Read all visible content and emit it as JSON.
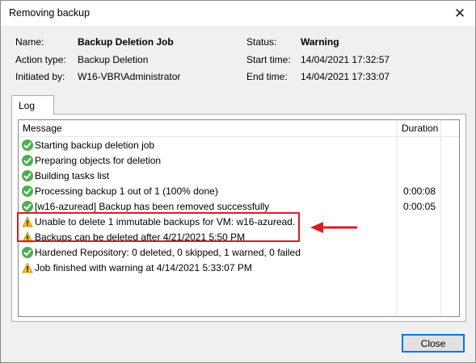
{
  "window": {
    "title": "Removing backup"
  },
  "info": {
    "name_label": "Name:",
    "name_value": "Backup Deletion Job",
    "action_label": "Action type:",
    "action_value": "Backup Deletion",
    "initiated_label": "Initiated by:",
    "initiated_value": "W16-VBR\\Administrator",
    "status_label": "Status:",
    "status_value": "Warning",
    "start_label": "Start time:",
    "start_value": "14/04/2021 17:32:57",
    "end_label": "End time:",
    "end_value": "14/04/2021 17:33:07"
  },
  "tabs": [
    {
      "label": "Log"
    }
  ],
  "log": {
    "columns": {
      "message": "Message",
      "duration": "Duration"
    },
    "rows": [
      {
        "status": "success",
        "message": "Starting backup deletion job",
        "duration": ""
      },
      {
        "status": "success",
        "message": "Preparing objects for deletion",
        "duration": ""
      },
      {
        "status": "success",
        "message": "Building tasks list",
        "duration": ""
      },
      {
        "status": "success",
        "message": "Processing backup 1 out of 1 (100% done)",
        "duration": "0:00:08"
      },
      {
        "status": "success",
        "message": "[w16-azuread] Backup has been removed successfully",
        "duration": "0:00:05"
      },
      {
        "status": "warning",
        "message": "Unable to delete 1 immutable backups for VM: w16-azuread.",
        "duration": ""
      },
      {
        "status": "warning",
        "message": "Backups can be deleted after 4/21/2021 5:50 PM",
        "duration": ""
      },
      {
        "status": "success",
        "message": "Hardened Repository: 0 deleted, 0 skipped, 1 warned, 0 failed",
        "duration": ""
      },
      {
        "status": "warning",
        "message": "Job finished with warning at 4/14/2021 5:33:07 PM",
        "duration": ""
      }
    ]
  },
  "buttons": {
    "close": "Close"
  },
  "colors": {
    "success": "#4caf50",
    "warning": "#f2c12e",
    "highlight": "#d51f1f",
    "accent": "#0078d7"
  },
  "icons": {
    "success": "check-circle-icon",
    "warning": "warning-triangle-icon",
    "window_close": "close-icon"
  }
}
